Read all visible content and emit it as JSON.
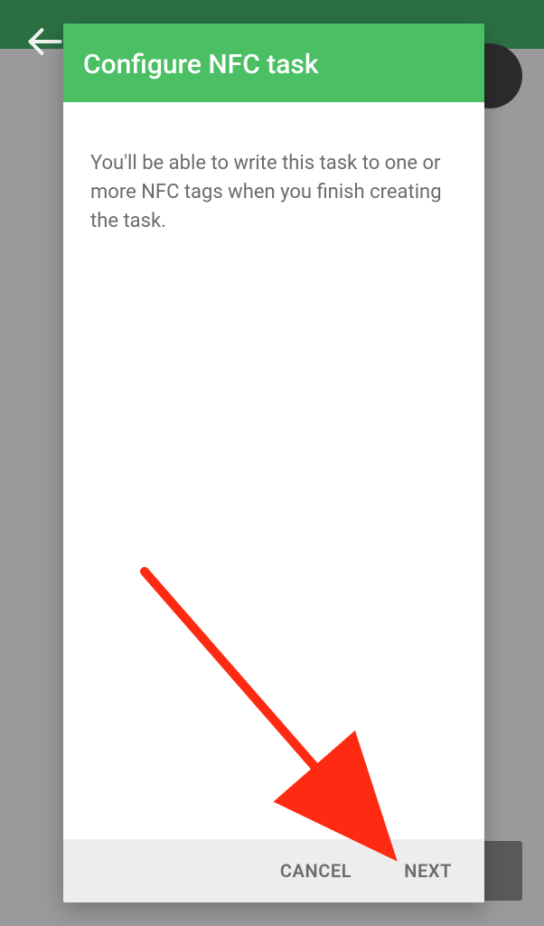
{
  "dialog": {
    "title": "Configure NFC task",
    "body_text": "You'll be able to write this task to one or more NFC tags when you finish creating the task.",
    "buttons": {
      "cancel": "CANCEL",
      "next": "NEXT"
    }
  },
  "colors": {
    "accent": "#4bbf63",
    "toolbar": "#1e6b3a",
    "annotation": "#ff2a12"
  }
}
